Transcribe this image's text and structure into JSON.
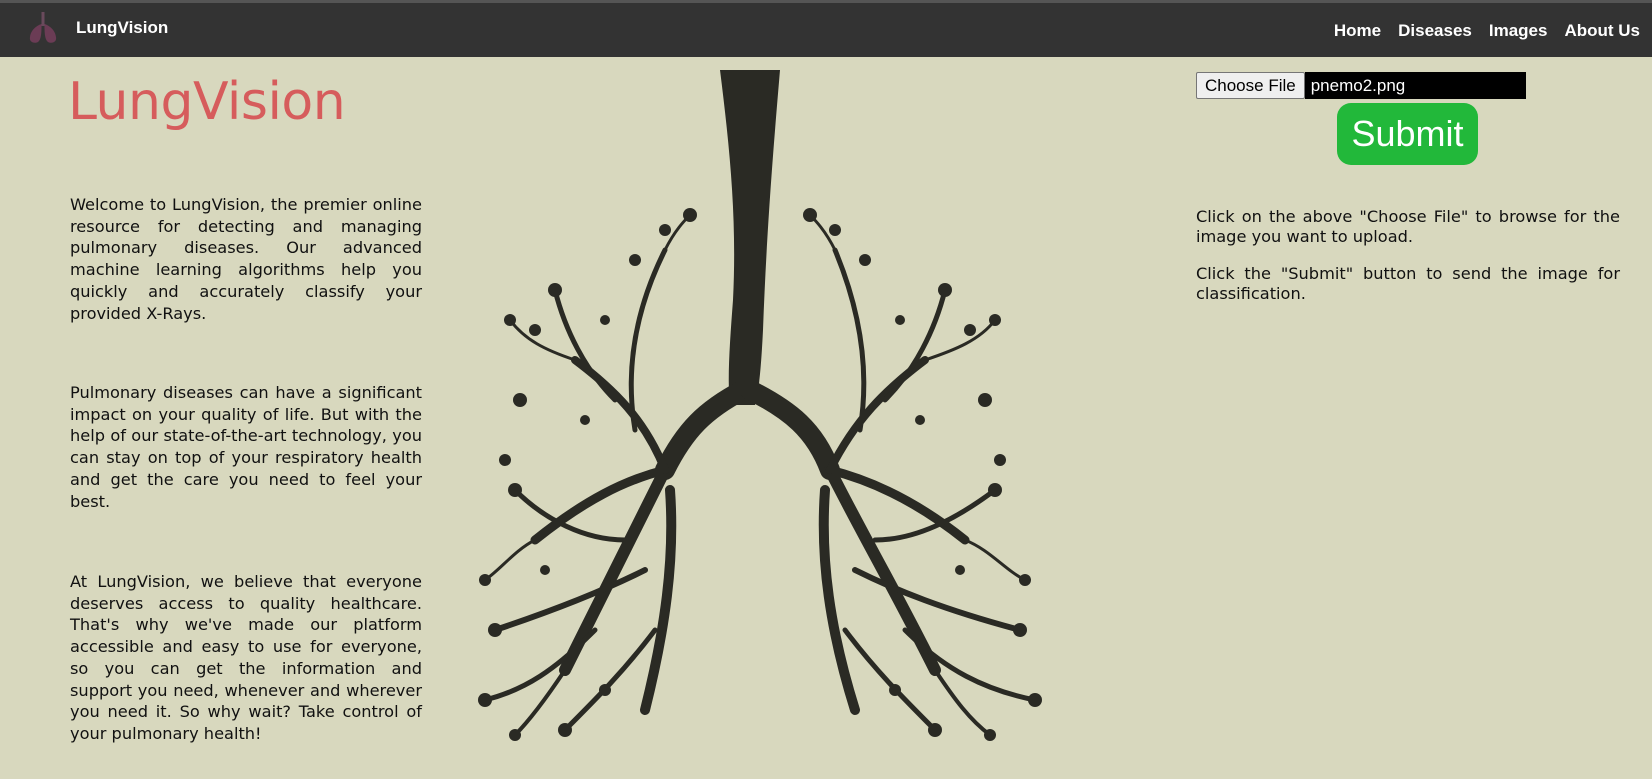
{
  "nav": {
    "brand": "LungVision",
    "links": [
      "Home",
      "Diseases",
      "Images",
      "About Us"
    ]
  },
  "hero": {
    "title": "LungVision",
    "paragraphs": [
      "Welcome to LungVision, the premier online resource for detecting and managing pulmonary diseases. Our advanced machine learning algorithms help you quickly and accurately classify your provided X-Rays.",
      "Pulmonary diseases can have a significant impact on your quality of life. But with the help of our state-of-the-art technology, you can stay on top of your respiratory health and get the care you need to feel your best.",
      "At LungVision, we believe that everyone deserves access to quality healthcare. That's why we've made our platform accessible and easy to use for everyone, so you can get the information and support you need, whenever and wherever you need it. So why wait? Take control of your pulmonary health!"
    ]
  },
  "upload": {
    "choose_label": "Choose File",
    "file_name": "pnemo2.png",
    "submit_label": "Submit",
    "instructions": [
      "Click on the above \"Choose File\" to browse for the image you want to upload.",
      "Click the \"Submit\" button to send the image for classification."
    ]
  },
  "colors": {
    "background": "#d8d8be",
    "navbar": "#333333",
    "title": "#d65c5c",
    "submit": "#22b83a"
  },
  "icons": {
    "brand_logo": "lungs-icon",
    "illustration": "tree-lungs-illustration"
  }
}
